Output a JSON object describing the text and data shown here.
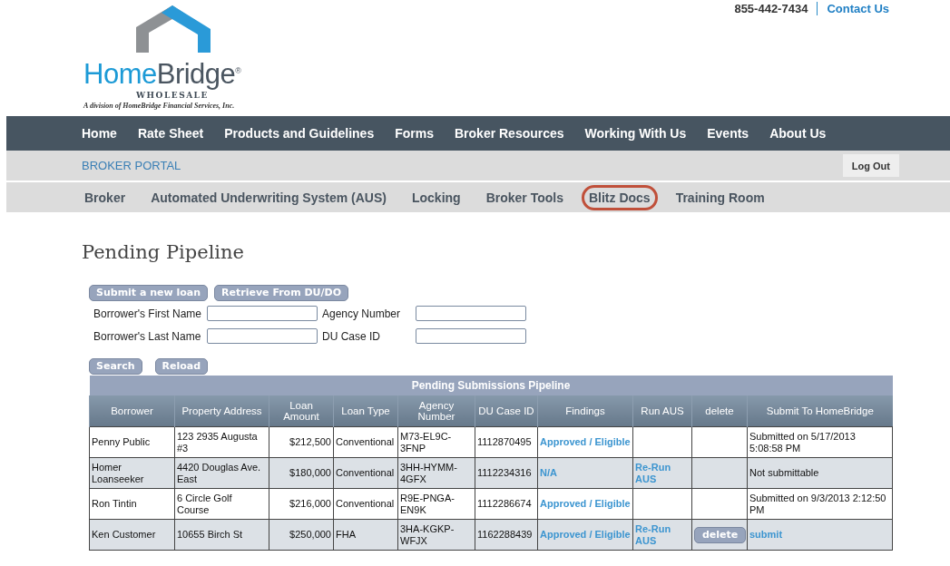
{
  "header": {
    "phone": "855-442-7434",
    "contact_link": "Contact Us"
  },
  "brand": {
    "name_part_1": "Home",
    "name_part_2": "Bridge",
    "registered_mark": "®",
    "division": "WHOLESALE",
    "tagline": "A division of HomeBridge Financial Services, Inc."
  },
  "main_nav": [
    "Home",
    "Rate Sheet",
    "Products and Guidelines",
    "Forms",
    "Broker Resources",
    "Working With Us",
    "Events",
    "About Us"
  ],
  "portal": {
    "title": "BROKER PORTAL",
    "logout_button": "Log Out"
  },
  "sub_nav": [
    {
      "label": "Broker",
      "circled": false
    },
    {
      "label": "Automated Underwriting System (AUS)",
      "circled": false
    },
    {
      "label": "Locking",
      "circled": false
    },
    {
      "label": "Broker Tools",
      "circled": false
    },
    {
      "label": "Blitz Docs",
      "circled": true
    },
    {
      "label": "Training Room",
      "circled": false
    }
  ],
  "page_title": "Pending Pipeline",
  "action_buttons": [
    "Submit a new loan",
    "Retrieve From DU/DO"
  ],
  "search_fields": [
    {
      "label": "Borrower's First Name"
    },
    {
      "label": "Agency Number"
    },
    {
      "label": "Borrower's Last Name"
    },
    {
      "label": "DU Case ID"
    }
  ],
  "search_buttons": [
    "Search",
    "Reload"
  ],
  "table": {
    "title": "Pending Submissions Pipeline",
    "columns": [
      "Borrower",
      "Property Address",
      "Loan Amount",
      "Loan Type",
      "Agency Number",
      "DU Case ID",
      "Findings",
      "Run AUS",
      "delete",
      "Submit To HomeBridge"
    ],
    "rows": [
      {
        "borrower": "Penny Public",
        "address": "123 2935 Augusta #3",
        "amount": "$212,500",
        "loan_type": "Conventional",
        "agency_number": "M73-EL9C-3FNP",
        "du_case_id": "1112870495",
        "findings": "Approved / Eligible",
        "submit": {
          "kind": "text",
          "text": "Submitted on 5/17/2013 5:08:58 PM"
        }
      },
      {
        "borrower": "Homer Loanseeker",
        "address": "4420 Douglas Ave. East",
        "amount": "$180,000",
        "loan_type": "Conventional",
        "agency_number": "3HH-HYMM-4GFX",
        "du_case_id": "1112234316",
        "findings": "N/A",
        "run_aus": "Re-Run AUS",
        "submit": {
          "kind": "text",
          "text": "Not submittable"
        }
      },
      {
        "borrower": "Ron Tintin",
        "address": "6 Circle Golf Course",
        "amount": "$216,000",
        "loan_type": "Conventional",
        "agency_number": "R9E-PNGA-EN9K",
        "du_case_id": "1112286674",
        "findings": "Approved / Eligible",
        "submit": {
          "kind": "text",
          "text": "Submitted on 9/3/2013 2:12:50 PM"
        }
      },
      {
        "borrower": "Ken Customer",
        "address": "10655 Birch St",
        "amount": "$250,000",
        "loan_type": "FHA",
        "agency_number": "3HA-KGKP-WFJX",
        "du_case_id": "1162288439",
        "findings": "Approved / Eligible",
        "run_aus": "Re-Run AUS",
        "delete_button": "delete",
        "submit": {
          "kind": "link",
          "text": "submit"
        }
      }
    ]
  }
}
